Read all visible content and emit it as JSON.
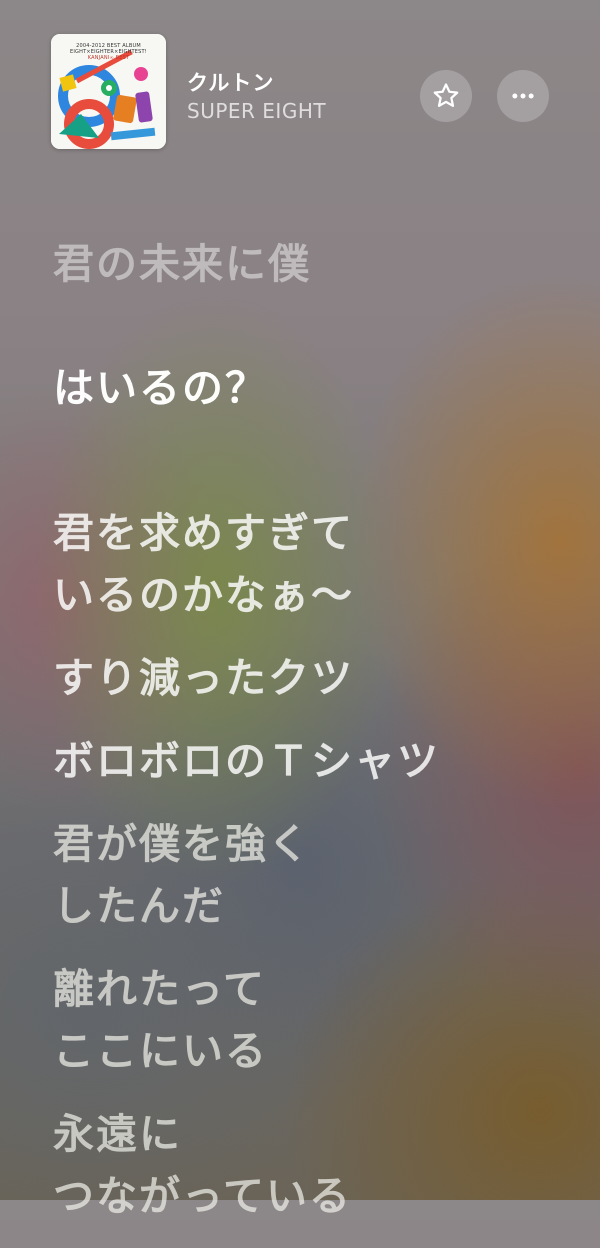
{
  "now_playing": {
    "title": "クルトン",
    "artist": "SUPER EIGHT",
    "artwork": {
      "caption_line1": "2004-2012 BEST ALBUM",
      "caption_line2": "EIGHT×EIGHTER×EIGHTEST!",
      "caption_line3": "KANJANI∞ BEST",
      "logo_text": "KANJANI8 BEST"
    },
    "actions": {
      "favorite_icon": "star-icon",
      "more_icon": "ellipsis-icon"
    }
  },
  "lyrics": {
    "current": {
      "sung": "君の未来に僕",
      "upcoming": "はいるの？"
    },
    "lines": [
      "君を求めすぎて\nいるのかなぁ～",
      "すり減ったクツ",
      "ボロボロのＴシャツ",
      "君が僕を強く\nしたんだ",
      "離れたって\nここにいる",
      "永遠に\nつながっている"
    ]
  }
}
